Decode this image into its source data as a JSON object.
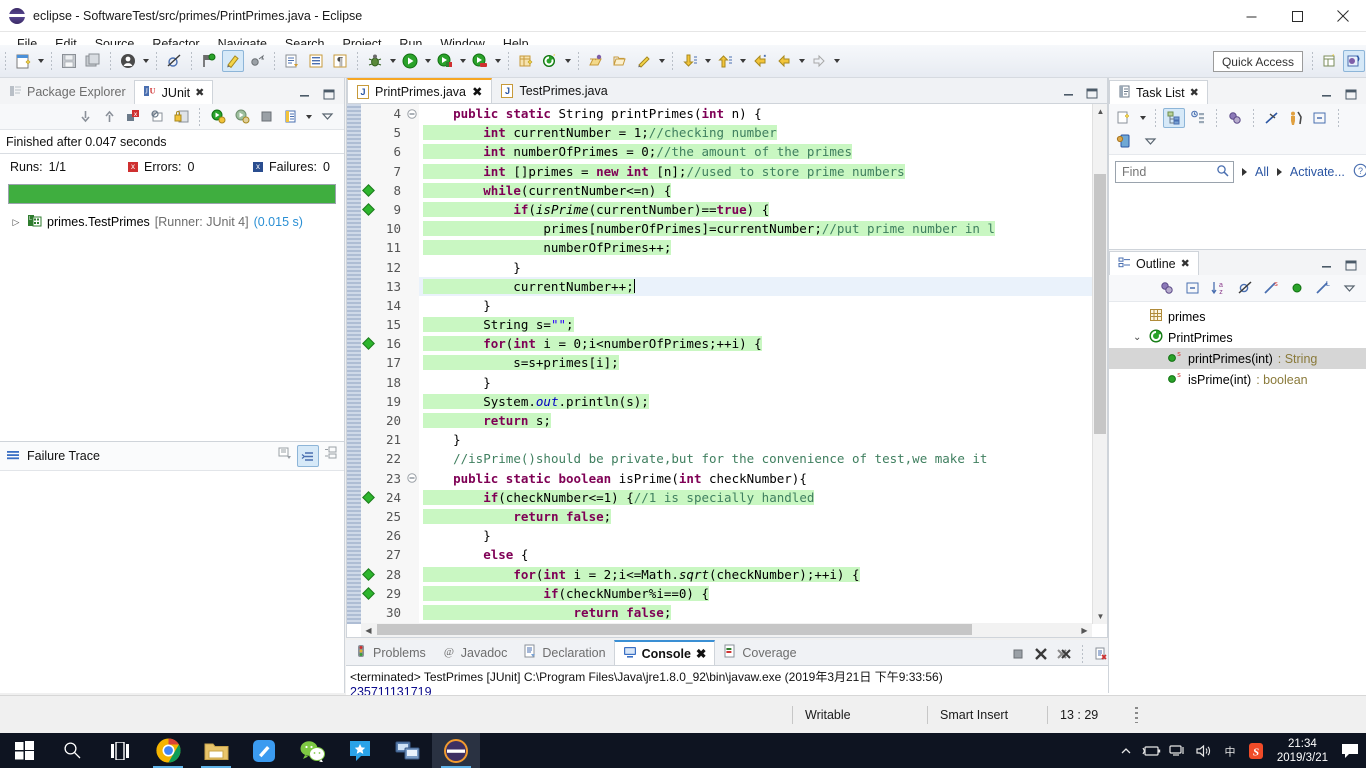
{
  "window": {
    "title": "eclipse - SoftwareTest/src/primes/PrintPrimes.java - Eclipse",
    "icon": "eclipse-icon",
    "minimize": "—",
    "maximize": "☐",
    "close": "✕"
  },
  "menu": {
    "items": [
      "File",
      "Edit",
      "Source",
      "Refactor",
      "Navigate",
      "Search",
      "Project",
      "Run",
      "Window",
      "Help"
    ]
  },
  "toolbar": {
    "quick_access": "Quick Access"
  },
  "left_panel": {
    "tabs": [
      {
        "label": "Package Explorer",
        "icon": "package-explorer-icon",
        "active": false,
        "closeable": false
      },
      {
        "label": "JUnit",
        "icon": "junit-icon",
        "active": true,
        "closeable": true
      }
    ],
    "minimize_title": "Minimize",
    "maximize_title": "Maximize",
    "status": "Finished after 0.047 seconds",
    "runs_label": "Runs:",
    "runs_value": "1/1",
    "errors_label": "Errors:",
    "errors_value": "0",
    "failures_label": "Failures:",
    "failures_value": "0",
    "progress_percent": 100,
    "progress_color": "#3fae3f",
    "tree": [
      {
        "name": "primes.TestPrimes",
        "runner": "[Runner: JUnit 4]",
        "time": "(0.015 s)",
        "icon": "test-class-icon",
        "expander": "›"
      }
    ],
    "failure_trace_title": "Failure Trace"
  },
  "editor": {
    "tabs": [
      {
        "label": "PrintPrimes.java",
        "active": true,
        "closeable": true
      },
      {
        "label": "TestPrimes.java",
        "active": false,
        "closeable": false
      }
    ],
    "first_line_number": 4,
    "current_line": 13,
    "lines": [
      {
        "n": 4,
        "fold": "collapse",
        "marker": "",
        "html": "    <span class='kw'>public</span> <span class='kw'>static</span> String printPrimes(<span class='kw'>int</span> n) {",
        "hl": false
      },
      {
        "n": 5,
        "fold": "",
        "marker": "",
        "html": "        <span class='kw'>int</span> currentNumber = 1;<span class='cmt'>//checking number</span>",
        "hl": true
      },
      {
        "n": 6,
        "fold": "",
        "marker": "",
        "html": "        <span class='kw'>int</span> numberOfPrimes = 0;<span class='cmt'>//the amount of the primes</span>",
        "hl": true
      },
      {
        "n": 7,
        "fold": "",
        "marker": "",
        "html": "        <span class='kw'>int</span> []primes = <span class='kw'>new</span> <span class='kw'>int</span> [n];<span class='cmt'>//used to store prime numbers</span>",
        "hl": true
      },
      {
        "n": 8,
        "fold": "",
        "marker": "diamond",
        "html": "        <span class='kw'>while</span>(currentNumber&lt;=n) {",
        "hl": true
      },
      {
        "n": 9,
        "fold": "",
        "marker": "diamond",
        "html": "            <span class='kw'>if</span>(<span class='mth'>isPrime</span>(currentNumber)==<span class='kw'>true</span>) {",
        "hl": true
      },
      {
        "n": 10,
        "fold": "",
        "marker": "",
        "html": "                primes[numberOfPrimes]=currentNumber;<span class='cmt'>//put prime number in l</span>",
        "hl": true
      },
      {
        "n": 11,
        "fold": "",
        "marker": "",
        "html": "                numberOfPrimes++;",
        "hl": true
      },
      {
        "n": 12,
        "fold": "",
        "marker": "",
        "html": "            }",
        "hl": false
      },
      {
        "n": 13,
        "fold": "",
        "marker": "",
        "html": "            currentNumber++;<span class='caret'></span>",
        "hl": true
      },
      {
        "n": 14,
        "fold": "",
        "marker": "",
        "html": "        }",
        "hl": false
      },
      {
        "n": 15,
        "fold": "",
        "marker": "",
        "html": "        String s=<span class='str'>\"\"</span>;",
        "hl": true
      },
      {
        "n": 16,
        "fold": "",
        "marker": "diamond",
        "html": "        <span class='kw'>for</span>(<span class='kw'>int</span> i = 0;i&lt;numberOfPrimes;++i) {",
        "hl": true
      },
      {
        "n": 17,
        "fold": "",
        "marker": "",
        "html": "            s=s+primes[i];",
        "hl": true
      },
      {
        "n": 18,
        "fold": "",
        "marker": "",
        "html": "        }",
        "hl": false
      },
      {
        "n": 19,
        "fold": "",
        "marker": "",
        "html": "        System.<span class='fld'>out</span>.println(s);",
        "hl": true
      },
      {
        "n": 20,
        "fold": "",
        "marker": "",
        "html": "        <span class='kw'>return</span> s;",
        "hl": true
      },
      {
        "n": 21,
        "fold": "",
        "marker": "",
        "html": "    }",
        "hl": false
      },
      {
        "n": 22,
        "fold": "",
        "marker": "",
        "html": "    <span class='cmt'>//isPrime()should be private,but for the convenience of test,we make it</span>",
        "hl": false
      },
      {
        "n": 23,
        "fold": "collapse",
        "marker": "",
        "html": "    <span class='kw'>public</span> <span class='kw'>static</span> <span class='kw'>boolean</span> isPrime(<span class='kw'>int</span> checkNumber){",
        "hl": false
      },
      {
        "n": 24,
        "fold": "",
        "marker": "diamond",
        "html": "        <span class='kw'>if</span>(checkNumber&lt;=1) {<span class='cmt'>//1 is specially handled</span>",
        "hl": true
      },
      {
        "n": 25,
        "fold": "",
        "marker": "",
        "html": "            <span class='kw'>return</span> <span class='kw'>false</span>;",
        "hl": true
      },
      {
        "n": 26,
        "fold": "",
        "marker": "",
        "html": "        }",
        "hl": false
      },
      {
        "n": 27,
        "fold": "",
        "marker": "",
        "html": "        <span class='kw'>else</span> {",
        "hl": false
      },
      {
        "n": 28,
        "fold": "",
        "marker": "diamond",
        "html": "            <span class='kw'>for</span>(<span class='kw'>int</span> i = 2;i&lt;=Math.<span class='mth'>sqrt</span>(checkNumber);++i) {",
        "hl": true
      },
      {
        "n": 29,
        "fold": "",
        "marker": "diamond",
        "html": "                <span class='kw'>if</span>(checkNumber%i==0) {",
        "hl": true
      },
      {
        "n": 30,
        "fold": "",
        "marker": "",
        "html": "                    <span class='kw'>return</span> <span class='kw'>false</span>;",
        "hl": true
      }
    ]
  },
  "console": {
    "tabs": [
      {
        "label": "Problems",
        "icon": "problems-icon",
        "active": false,
        "closeable": false
      },
      {
        "label": "Javadoc",
        "icon": "javadoc-icon",
        "active": false,
        "closeable": false
      },
      {
        "label": "Declaration",
        "icon": "declaration-icon",
        "active": false,
        "closeable": false
      },
      {
        "label": "Console",
        "icon": "console-icon",
        "active": true,
        "closeable": true
      },
      {
        "label": "Coverage",
        "icon": "coverage-icon",
        "active": false,
        "closeable": false
      }
    ],
    "launch_line": "<terminated> TestPrimes [JUnit] C:\\Program Files\\Java\\jre1.8.0_92\\bin\\javaw.exe (2019年3月21日 下午9:33:56)",
    "output": "235711131719"
  },
  "task_list": {
    "tab_label": "Task List",
    "tab_icon": "task-list-icon",
    "find_placeholder": "Find",
    "find_value": "",
    "all_label": "All",
    "activate_label": "Activate..."
  },
  "outline": {
    "tab_label": "Outline",
    "tab_icon": "outline-icon",
    "items": [
      {
        "label": "primes",
        "type": "",
        "icon": "package-icon",
        "indent": 1,
        "expander": "",
        "selected": false
      },
      {
        "label": "PrintPrimes",
        "type": "",
        "icon": "class-icon",
        "indent": 1,
        "expander": "⌄",
        "selected": false
      },
      {
        "label": "printPrimes(int)",
        "type": " : String",
        "icon": "method-public-static-icon",
        "indent": 2,
        "expander": "",
        "selected": true
      },
      {
        "label": "isPrime(int)",
        "type": " : boolean",
        "icon": "method-public-static-icon",
        "indent": 2,
        "expander": "",
        "selected": false
      }
    ]
  },
  "status_bar": {
    "writable": "Writable",
    "insert_mode": "Smart Insert",
    "position": "13 : 29"
  },
  "taskbar": {
    "items": [
      {
        "name": "start-button",
        "icon": "windows-logo-icon",
        "active": false,
        "running": false
      },
      {
        "name": "search-button",
        "icon": "search-icon",
        "active": false,
        "running": false
      },
      {
        "name": "task-view-button",
        "icon": "task-view-icon",
        "active": false,
        "running": false
      },
      {
        "name": "chrome",
        "icon": "chrome-icon",
        "active": false,
        "running": true
      },
      {
        "name": "file-explorer",
        "icon": "folder-icon",
        "active": false,
        "running": true
      },
      {
        "name": "notepad",
        "icon": "editor-icon",
        "active": false,
        "running": false
      },
      {
        "name": "wechat",
        "icon": "wechat-icon",
        "active": false,
        "running": false
      },
      {
        "name": "qq",
        "icon": "qq-icon",
        "active": false,
        "running": false
      },
      {
        "name": "remote-desktop",
        "icon": "remote-desktop-icon",
        "active": false,
        "running": false
      },
      {
        "name": "eclipse",
        "icon": "eclipse-icon",
        "active": true,
        "running": true
      }
    ],
    "tray": [
      "chevron-up-icon",
      "battery-icon",
      "network-icon",
      "volume-icon",
      "ime-icon",
      "sogou-icon"
    ],
    "clock_time": "21:34",
    "clock_date": "2019/3/21",
    "notification_icon": "notification-icon"
  },
  "colors": {
    "accent": "#2a55a3",
    "success": "#3fae3f",
    "highlight": "#c9f7c2",
    "current_line": "#eaf2fb",
    "keyword": "#7f0055",
    "comment": "#3f7f5f",
    "string": "#2a00ff"
  }
}
